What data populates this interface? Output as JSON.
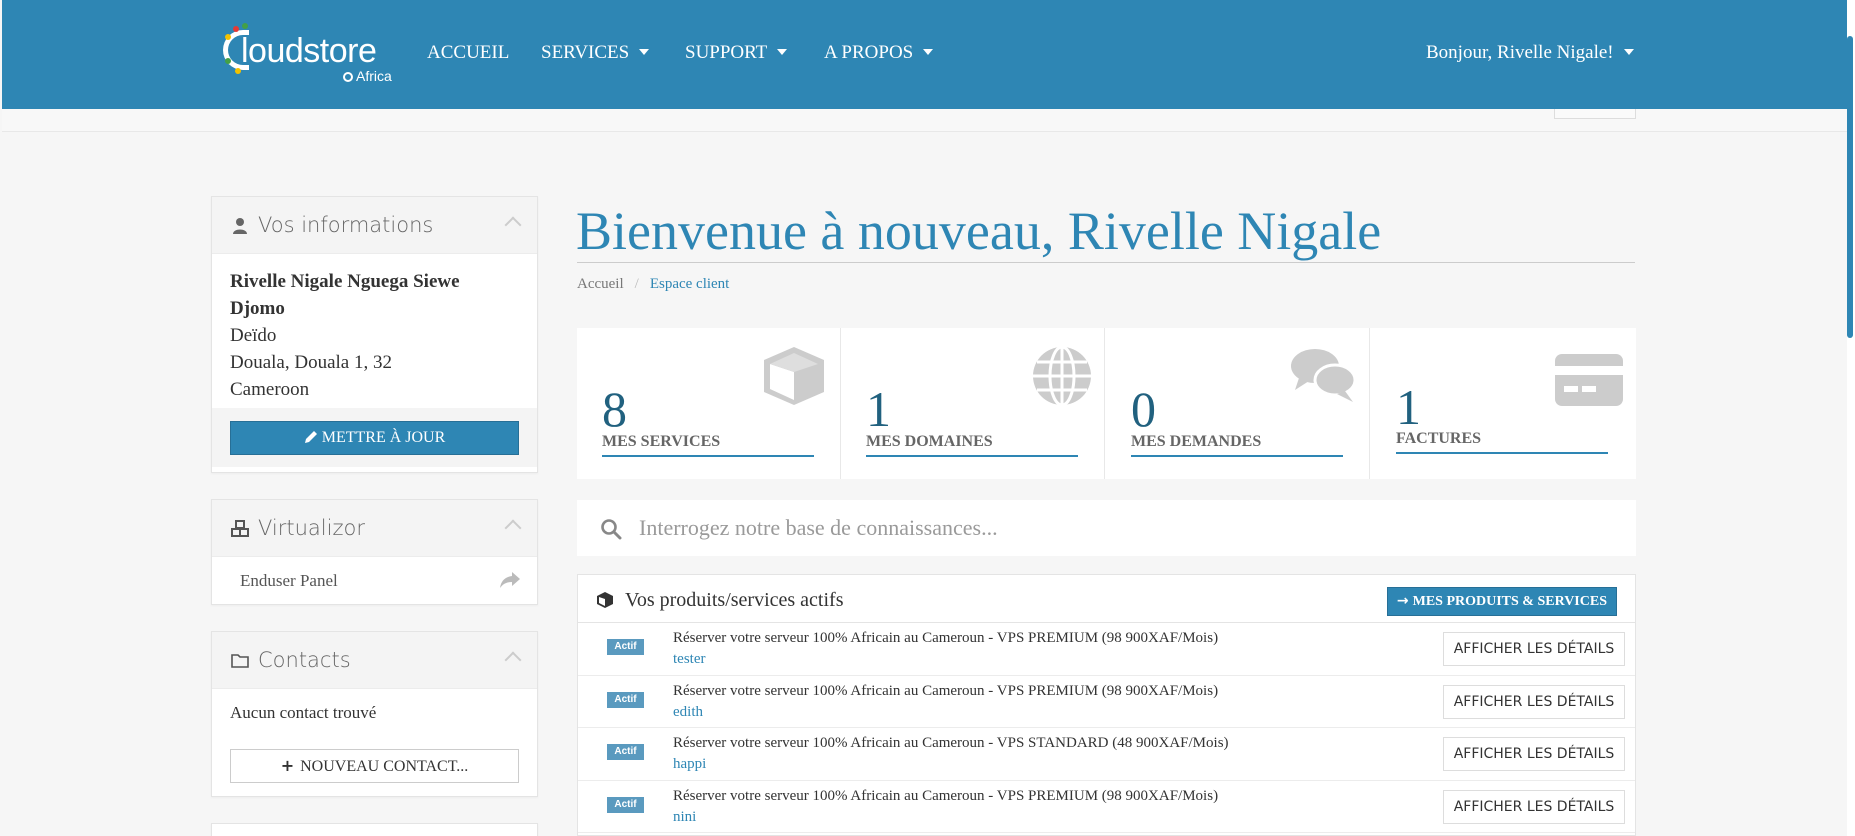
{
  "brand": {
    "logo_text": "loudstore",
    "logo_sub": "Africa"
  },
  "nav": {
    "items": [
      {
        "label": "ACCUEIL"
      },
      {
        "label": "SERVICES"
      },
      {
        "label": "SUPPORT"
      },
      {
        "label": "A PROPOS"
      }
    ],
    "greeting": "Bonjour, Rivelle Nigale!"
  },
  "sidebar": {
    "info": {
      "title": "Vos informations",
      "name": "Rivelle Nigale Nguega Siewe Djomo",
      "address1": "Deïdo",
      "address2": "Douala, Douala 1, 32",
      "country": "Cameroon",
      "update_label": "METTRE À JOUR"
    },
    "virtualizor": {
      "title": "Virtualizor",
      "link_label": "Enduser Panel"
    },
    "contacts": {
      "title": "Contacts",
      "empty_text": "Aucun contact trouvé",
      "new_label": "NOUVEAU CONTACT..."
    }
  },
  "main": {
    "welcome": "Bienvenue à nouveau, Rivelle Nigale",
    "breadcrumb": {
      "home": "Accueil",
      "separator": "/",
      "current": "Espace client"
    },
    "tiles": [
      {
        "value": "8",
        "label": "MES SERVICES",
        "icon": "cube-icon"
      },
      {
        "value": "1",
        "label": "MES DOMAINES",
        "icon": "globe-icon"
      },
      {
        "value": "0",
        "label": "MES DEMANDES",
        "icon": "comments-icon"
      },
      {
        "value": "1",
        "label": "FACTURES",
        "icon": "credit-card-icon"
      }
    ],
    "search": {
      "placeholder": "Interrogez notre base de connaissances..."
    },
    "products": {
      "title": "Vos produits/services actifs",
      "all_button": "MES PRODUITS & SERVICES",
      "rows": [
        {
          "status": "Actif",
          "title": "Réserver votre serveur 100% Africain au Cameroun - VPS PREMIUM (98 900XAF/Mois)",
          "user": "tester",
          "action": "AFFICHER LES DÉTAILS"
        },
        {
          "status": "Actif",
          "title": "Réserver votre serveur 100% Africain au Cameroun - VPS PREMIUM (98 900XAF/Mois)",
          "user": "edith",
          "action": "AFFICHER LES DÉTAILS"
        },
        {
          "status": "Actif",
          "title": "Réserver votre serveur 100% Africain au Cameroun - VPS STANDARD (48 900XAF/Mois)",
          "user": "happi",
          "action": "AFFICHER LES DÉTAILS"
        },
        {
          "status": "Actif",
          "title": "Réserver votre serveur 100% Africain au Cameroun - VPS PREMIUM (98 900XAF/Mois)",
          "user": "nini",
          "action": "AFFICHER LES DÉTAILS"
        }
      ]
    }
  },
  "colors": {
    "primary": "#2e86b4",
    "badge": "#5a9abf",
    "tile_icon": "#cccccc"
  }
}
